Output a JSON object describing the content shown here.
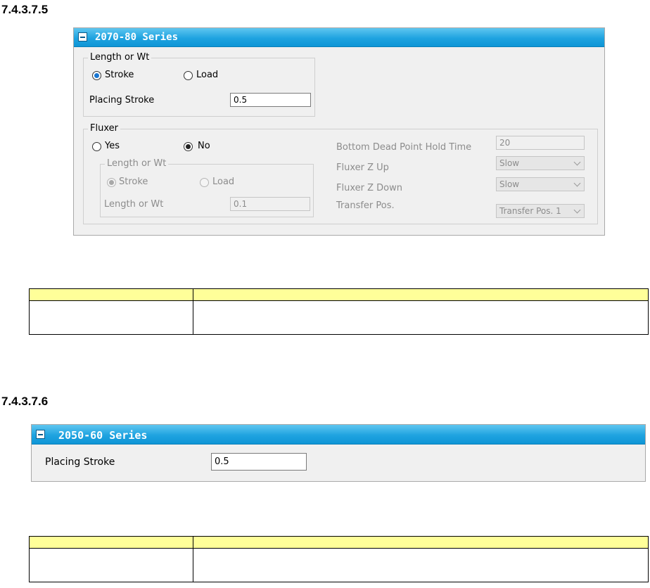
{
  "section1": {
    "heading": "7.4.3.7.5",
    "panel_title": "2070-80 Series",
    "length_group": {
      "legend": "Length or Wt",
      "radio_stroke": "Stroke",
      "radio_load": "Load",
      "selected": "Stroke",
      "placing_label": "Placing Stroke",
      "placing_value": "0.5"
    },
    "fluxer_group": {
      "legend": "Fluxer",
      "radio_yes": "Yes",
      "radio_no": "No",
      "selected": "No",
      "sub_group": {
        "legend": "Length or Wt",
        "radio_stroke": "Stroke",
        "radio_load": "Load",
        "selected": "Stroke",
        "field_label": "Length or Wt",
        "field_value": "0.1"
      },
      "bottom_dead_label": "Bottom Dead Point Hold Time",
      "bottom_dead_value": "20",
      "z_up_label": "Fluxer Z Up",
      "z_up_value": "Slow",
      "z_down_label": "Fluxer Z Down",
      "z_down_value": "Slow",
      "transfer_label": "Transfer Pos.",
      "transfer_value": "Transfer Pos. 1"
    },
    "table": {
      "header": [
        "",
        ""
      ],
      "row": [
        "",
        ""
      ]
    }
  },
  "section2": {
    "heading": "7.4.3.7.6",
    "panel_title": "2050-60 Series",
    "placing_label": "Placing Stroke",
    "placing_value": "0.5",
    "table": {
      "header": [
        "",
        ""
      ],
      "row": [
        "",
        ""
      ]
    }
  },
  "colors": {
    "header_blue": "#1fa3e0",
    "radio_selected": "#1976d2",
    "table_header_yellow": "#ffff99"
  }
}
